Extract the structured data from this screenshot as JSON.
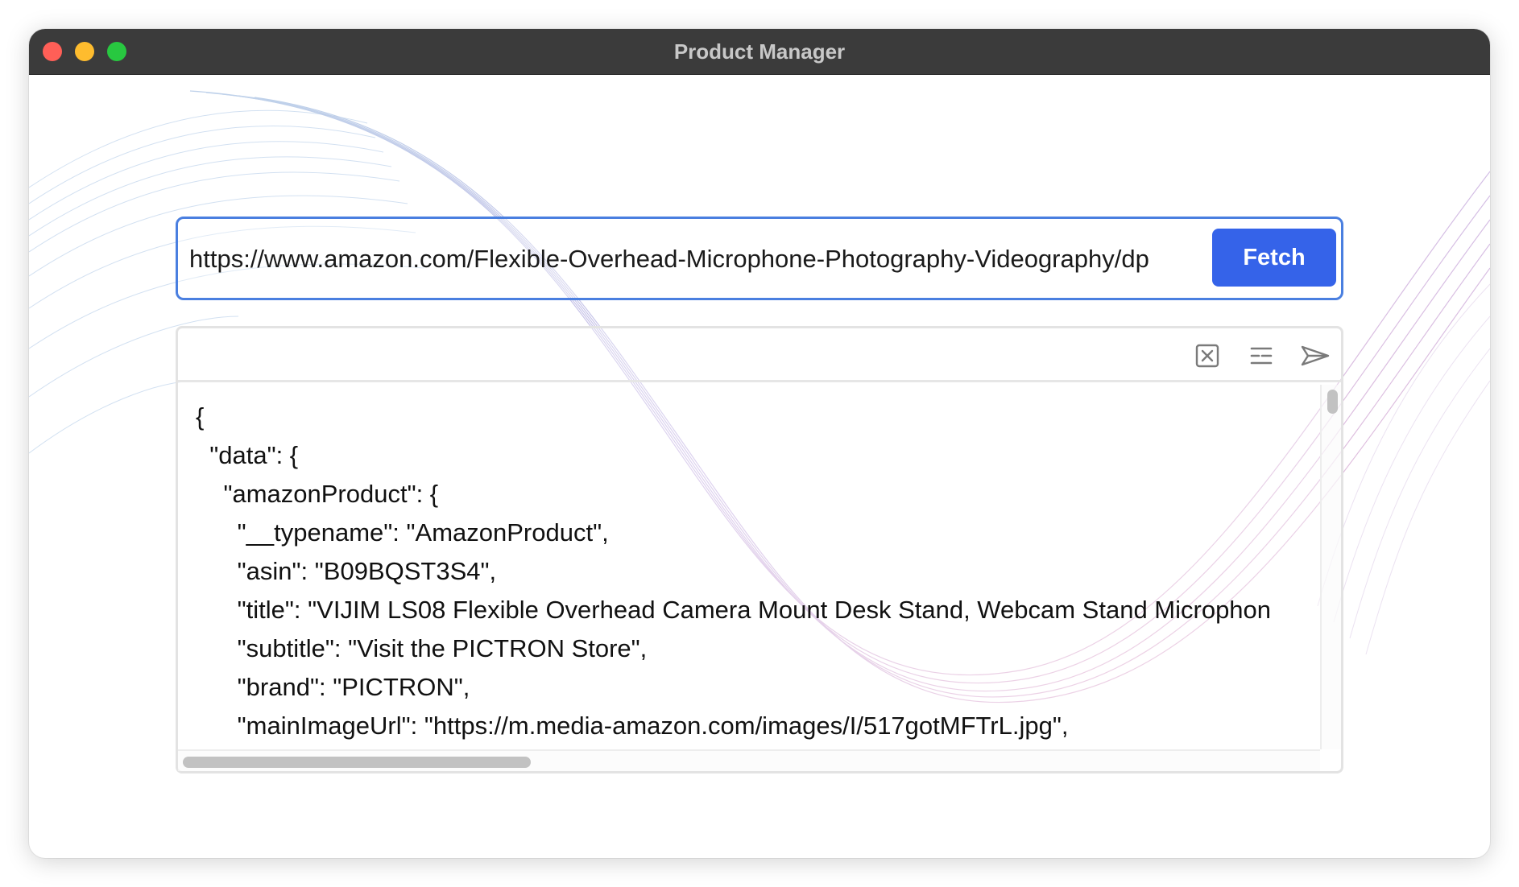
{
  "window": {
    "title": "Product Manager"
  },
  "fetcher": {
    "url_value": "https://www.amazon.com/Flexible-Overhead-Microphone-Photography-Videography/dp",
    "fetch_label": "Fetch"
  },
  "toolbar": {
    "icons": [
      "clear-icon",
      "format-lines-icon",
      "send-icon"
    ]
  },
  "editor": {
    "lines": [
      "{",
      "  \"data\": {",
      "    \"amazonProduct\": {",
      "      \"__typename\": \"AmazonProduct\",",
      "      \"asin\": \"B09BQST3S4\",",
      "      \"title\": \"VIJIM LS08 Flexible Overhead Camera Mount Desk Stand, Webcam Stand Microphon",
      "      \"subtitle\": \"Visit the PICTRON Store\",",
      "      \"brand\": \"PICTRON\",",
      "      \"mainImageUrl\": \"https://m.media-amazon.com/images/I/517gotMFTrL.jpg\","
    ]
  },
  "colors": {
    "accent": "#3563e9",
    "input_border": "#4a7fe0",
    "titlebar": "#3b3b3b"
  }
}
